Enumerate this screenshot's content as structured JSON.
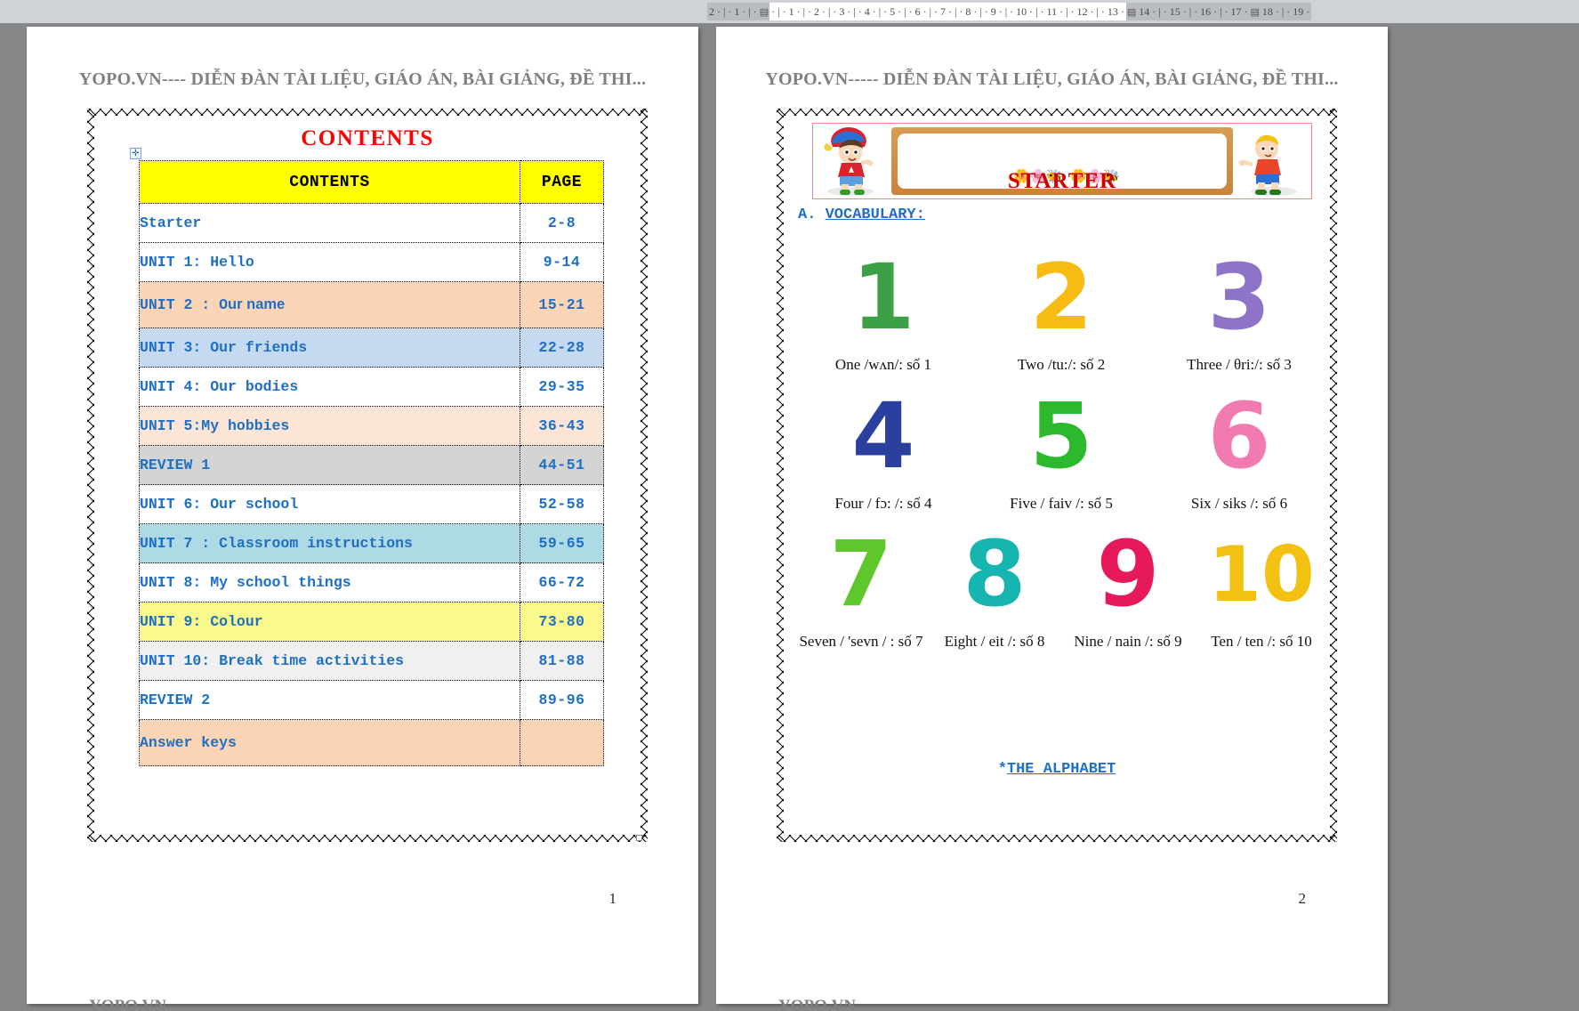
{
  "ruler": {
    "left_margin_ticks": "2 · | · 1 · | ·",
    "main_ticks": "· | · 1 · | · 2 · | · 3 · | · 4 · | · 5 · | · 6 · | · 7 · | · 8 · | · 9 · | · 10 · | · 11 · | · 12 · | · 13 ·",
    "right_ticks": "14 · | · 15 · | · 16 · | · 17 ·",
    "far_right_ticks": "18 · | · 19 ·",
    "indent_marker": "▤"
  },
  "colors": {
    "title_red": "#ff0000",
    "header_gray": "#808080",
    "link_blue": "#1f6fc4",
    "head_yellow": "#ffff00"
  },
  "left_page": {
    "header": "YOPO.VN---- DIỄN ĐÀN TÀI LIỆU, GIÁO ÁN, BÀI GIẢNG, ĐỀ THI...",
    "title": "CONTENTS",
    "page_number": "1",
    "footer": "YOPO.VN",
    "table": {
      "columns": [
        "CONTENTS",
        "PAGE"
      ],
      "rows": [
        {
          "title": "Starter",
          "title2": "",
          "page": "2-8",
          "bg": "#ffffff"
        },
        {
          "title": "UNIT 1: Hello",
          "title2": "",
          "page": "9-14",
          "bg": "#ffffff"
        },
        {
          "title": "UNIT 2 : O",
          "title2": "ur name",
          "page": "15-21",
          "bg": "#fbd5b5"
        },
        {
          "title": "UNIT 3: Our friends",
          "title2": "",
          "page": "22-28",
          "bg": "#c5d9f1"
        },
        {
          "title": "UNIT 4: Our bodies",
          "title2": "",
          "page": "29-35",
          "bg": "#ffffff"
        },
        {
          "title": "UNIT 5:My hobbies",
          "title2": "",
          "page": "36-43",
          "bg": "#fce4d6"
        },
        {
          "title": "REVIEW 1",
          "title2": "",
          "page": "44-51",
          "bg": "#d4d4d4"
        },
        {
          "title": "UNIT 6: Our school",
          "title2": "",
          "page": "52-58",
          "bg": "#ffffff"
        },
        {
          "title": "UNIT 7 : Classroom instructions",
          "title2": "",
          "page": "59-65",
          "bg": "#aedae6"
        },
        {
          "title": "UNIT 8: My school things",
          "title2": "",
          "page": "66-72",
          "bg": "#ffffff"
        },
        {
          "title": "UNIT  9: Colour",
          "title2": "",
          "page": "73-80",
          "bg": "#fafa8c"
        },
        {
          "title": "UNIT  10: Break time activities",
          "title2": "",
          "page": "81-88",
          "bg": "#f0f0f0"
        },
        {
          "title": "REVIEW 2",
          "title2": "",
          "page": "89-96",
          "bg": "#ffffff"
        },
        {
          "title": "Answer keys",
          "title2": "",
          "page": "",
          "bg": "#fbd5b5"
        }
      ]
    }
  },
  "right_page": {
    "header": "YOPO.VN----- DIỄN ĐÀN TÀI LIỆU, GIÁO ÁN, BÀI GIẢNG, ĐỀ THI...",
    "page_number": "2",
    "footer": "YOPO.VN",
    "banner": {
      "word": "STARTER",
      "left_kid": "girl-with-cap-illustration",
      "right_kid": "boy-illustration",
      "flowers": "flowers-and-bee-clipart"
    },
    "vocab_label": "A.",
    "vocab_heading": "VOCABULARY:",
    "numbers": [
      {
        "glyph": "1",
        "color": "#3ba046",
        "caption": "One /wʌn/: số 1",
        "art": "pig-with-number-one"
      },
      {
        "glyph": "2",
        "color": "#f6bc14",
        "caption": "Two /tu:/: số 2",
        "art": "pig-with-number-two"
      },
      {
        "glyph": "3",
        "color": "#8e74c8",
        "caption": "Three / θri:/: số 3",
        "art": "pig-with-number-three"
      },
      {
        "glyph": "4",
        "color": "#2a3f9e",
        "caption": "Four / fɔ: /: số 4",
        "art": "kids-with-number-four"
      },
      {
        "glyph": "5",
        "color": "#2db92d",
        "caption": "Five / faiv /: số 5",
        "art": "mice-with-number-five"
      },
      {
        "glyph": "6",
        "color": "#f17ab0",
        "caption": "Six / siks /: số 6",
        "art": "cat-chicks-with-number-six"
      },
      {
        "glyph": "7",
        "color": "#5ec72b",
        "caption": "Seven / 'sevn / : số 7",
        "art": "smiling-number-seven"
      },
      {
        "glyph": "8",
        "color": "#16b5b0",
        "caption": "Eight / eit /: số 8",
        "art": "singing-number-eight"
      },
      {
        "glyph": "9",
        "color": "#e61a5a",
        "caption": "Nine / nain /: số 9",
        "art": "girl-with-number-nine"
      },
      {
        "glyph": "10",
        "color": "#f2c111",
        "caption": "Ten / ten /: số 10",
        "art": "number-ten-characters"
      }
    ],
    "alphabet_star": "*",
    "alphabet_link": "THE ALPHABET"
  }
}
